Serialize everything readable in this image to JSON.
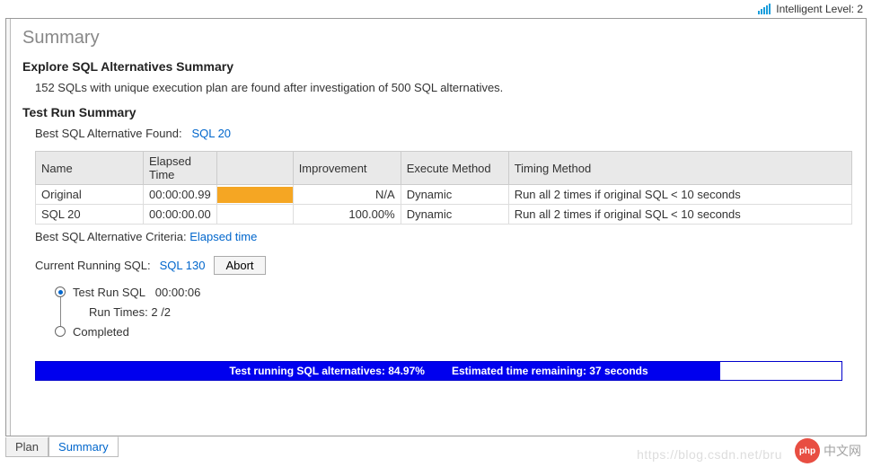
{
  "topbar": {
    "intelligent_label": "Intelligent Level: 2"
  },
  "page": {
    "title": "Summary"
  },
  "explore": {
    "heading": "Explore SQL Alternatives Summary",
    "body": "152 SQLs with unique execution plan are found after investigation of 500 SQL alternatives."
  },
  "testrun": {
    "heading": "Test Run Summary",
    "best_label": "Best SQL Alternative Found:",
    "best_value": "SQL 20",
    "table": {
      "headers": [
        "Name",
        "Elapsed Time",
        "",
        "Improvement",
        "Execute Method",
        "Timing Method"
      ],
      "rows": [
        {
          "name": "Original",
          "elapsed": "00:00:00.99",
          "bar_pct": 100,
          "improvement": "N/A",
          "exec": "Dynamic",
          "timing": "Run all 2 times if original SQL < 10 seconds"
        },
        {
          "name": "SQL 20",
          "elapsed": "00:00:00.00",
          "bar_pct": 0,
          "improvement": "100.00%",
          "exec": "Dynamic",
          "timing": "Run all 2 times if original SQL < 10 seconds"
        }
      ]
    },
    "criteria_label": "Best SQL Alternative Criteria:",
    "criteria_value": "Elapsed time"
  },
  "running": {
    "label": "Current Running SQL:",
    "value": "SQL 130",
    "abort": "Abort",
    "timeline": {
      "step1_label": "Test Run SQL",
      "step1_time": "00:00:06",
      "runtimes": "Run Times: 2 /2",
      "completed": "Completed"
    }
  },
  "progress": {
    "pct": 84.97,
    "text_left": "Test running SQL alternatives: 84.97%",
    "text_right": "Estimated time remaining: 37 seconds"
  },
  "tabs": {
    "plan": "Plan",
    "summary": "Summary"
  },
  "watermark": {
    "url": "https://blog.csdn.net/bru",
    "badge": "php",
    "site": "中文网"
  }
}
